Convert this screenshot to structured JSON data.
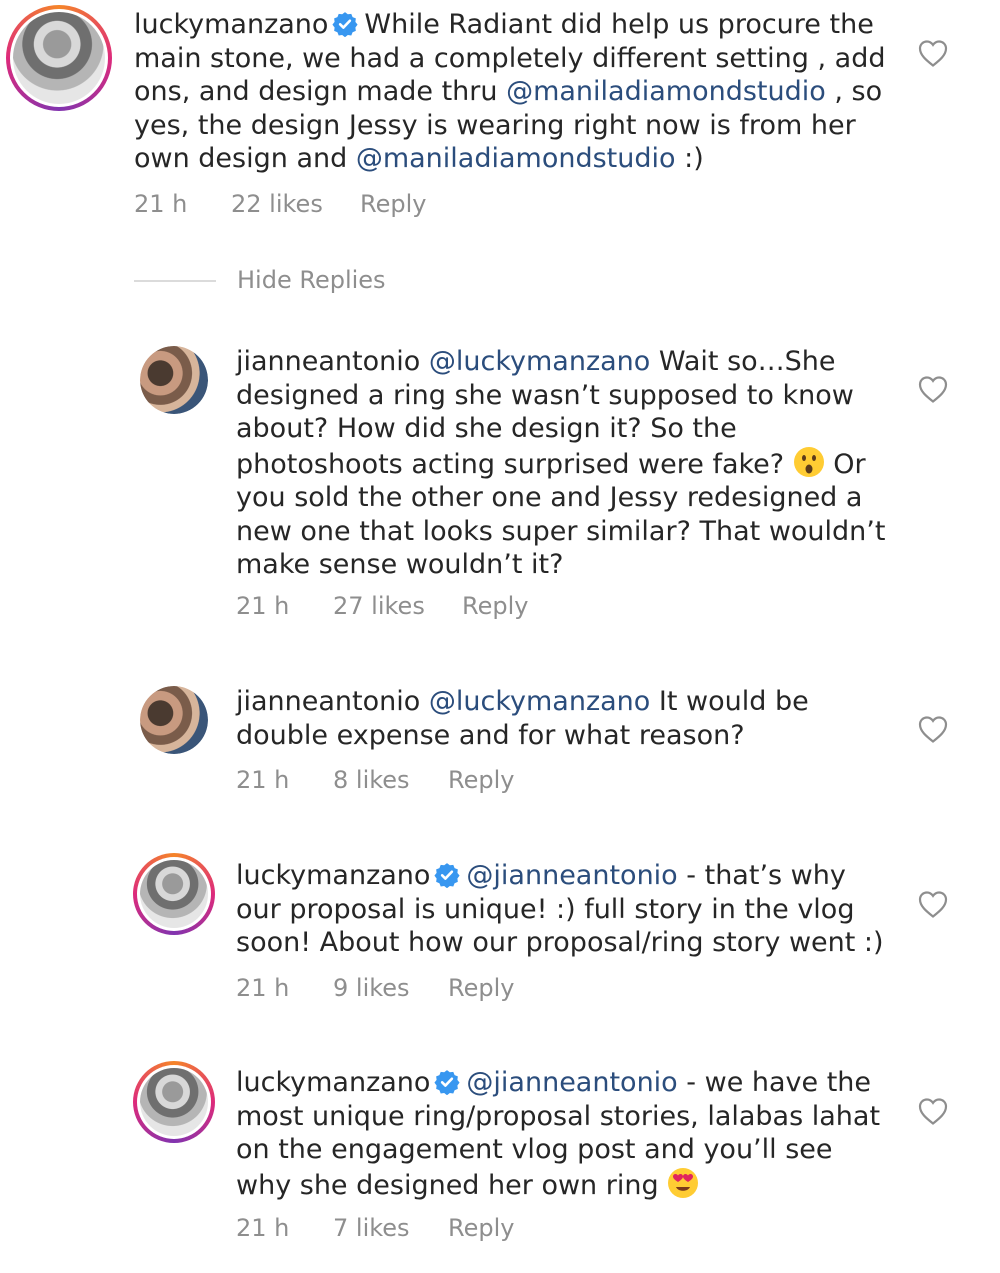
{
  "comments": [
    {
      "username": "luckymanzano",
      "verified": true,
      "mention": "",
      "text_before": "While Radiant did help us procure the main stone, we had a completely different setting , add ons, and design made thru ",
      "mention2": "@maniladiamondstudio",
      "text_mid": " , so yes, the design Jessy is wearing right now is from her own design and ",
      "mention3": "@maniladiamondstudio",
      "text_after": " :)",
      "time": "21 h",
      "likes": "22 likes",
      "reply": "Reply"
    },
    {
      "username": "jianneantonio",
      "verified": false,
      "mention": "@luckymanzano",
      "text": " Wait so…She designed a ring she wasn’t supposed to know about? How did she design it? So the photoshoots acting surprised were fake? ",
      "text_after": " Or you sold the other one and Jessy redesigned a new one that looks super similar? That wouldn’t make sense wouldn’t it?",
      "time": "21 h",
      "likes": "27 likes",
      "reply": "Reply"
    },
    {
      "username": "jianneantonio",
      "verified": false,
      "mention": "@luckymanzano",
      "text": " It would be double expense and for what reason?",
      "time": "21 h",
      "likes": "8 likes",
      "reply": "Reply"
    },
    {
      "username": "luckymanzano",
      "verified": true,
      "mention": "@jianneantonio",
      "text": " - that’s why our proposal is unique! :) full story in the vlog soon! About how our proposal/ring story went :)",
      "time": "21 h",
      "likes": "9 likes",
      "reply": "Reply"
    },
    {
      "username": "luckymanzano",
      "verified": true,
      "mention": "@jianneantonio",
      "text": " - we have the most unique ring/proposal stories, lalabas lahat on the engagement vlog post and you’ll see why she designed her own ring ",
      "time": "21 h",
      "likes": "7 likes",
      "reply": "Reply"
    }
  ],
  "hide_replies": "Hide Replies",
  "colors": {
    "mention": "#2b4d7c",
    "muted": "#8e8e8e",
    "verified": "#3897f0"
  }
}
